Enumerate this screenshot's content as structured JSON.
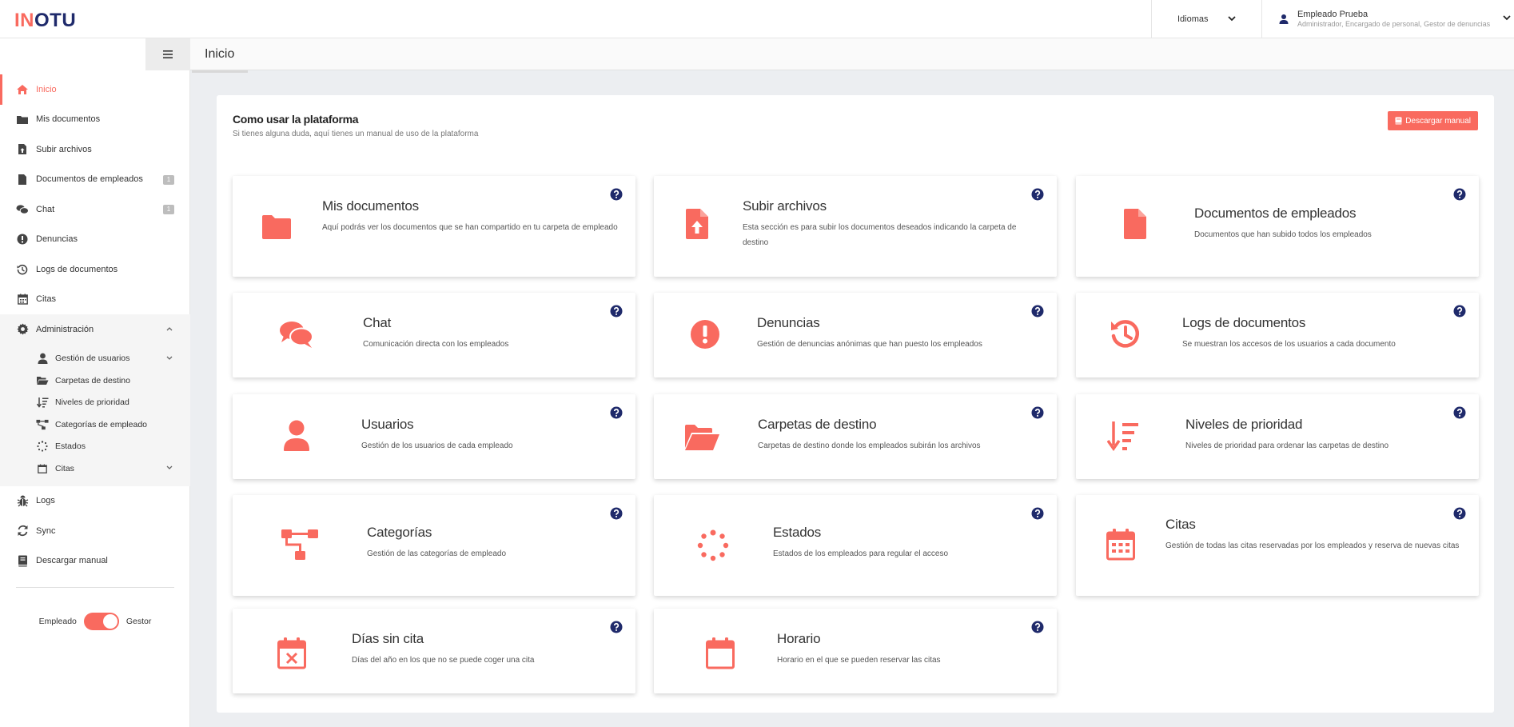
{
  "app": {
    "logo_pre": "IN",
    "logo_post": "OTU",
    "colors": {
      "accent": "#f96a5f",
      "navy": "#1f2a6b"
    }
  },
  "header": {
    "language_label": "Idiomas",
    "user_name": "Empleado Prueba",
    "user_roles": "Administrador, Encargado de personal, Gestor de denuncias"
  },
  "sidebar": {
    "items": [
      {
        "label": "Inicio",
        "icon": "home-icon"
      },
      {
        "label": "Mis documentos",
        "icon": "folder-icon"
      },
      {
        "label": "Subir archivos",
        "icon": "file-upload-icon"
      },
      {
        "label": "Documentos de empleados",
        "icon": "file-icon",
        "badge": "1"
      },
      {
        "label": "Chat",
        "icon": "comments-icon",
        "badge": "1"
      },
      {
        "label": "Denuncias",
        "icon": "exclamation-circle-icon"
      },
      {
        "label": "Logs de documentos",
        "icon": "history-icon"
      },
      {
        "label": "Citas",
        "icon": "calendar-icon"
      },
      {
        "label": "Administración",
        "icon": "cog-icon"
      }
    ],
    "admin_sub": [
      {
        "label": "Gestión de usuarios",
        "icon": "user-icon"
      },
      {
        "label": "Carpetas de destino",
        "icon": "folder-open-icon"
      },
      {
        "label": "Niveles de prioridad",
        "icon": "sort-amount-down-icon"
      },
      {
        "label": "Categorías de empleado",
        "icon": "sitemap-icon"
      },
      {
        "label": "Estados",
        "icon": "spinner-icon"
      },
      {
        "label": "Citas",
        "icon": "calendar-outline-icon"
      }
    ],
    "bottom": [
      {
        "label": "Logs",
        "icon": "bug-icon"
      },
      {
        "label": "Sync",
        "icon": "sync-icon"
      },
      {
        "label": "Descargar manual",
        "icon": "book-icon"
      }
    ],
    "toggle_left": "Empleado",
    "toggle_right": "Gestor"
  },
  "page": {
    "title": "Inicio",
    "panel_title": "Como usar la plataforma",
    "panel_subtitle": "Si tienes alguna duda, aquí tienes un manual de uso de la plataforma",
    "download_button": "Descargar manual"
  },
  "cards": [
    {
      "title": "Mis documentos",
      "desc": "Aquí podrás ver los documentos que se han compartido en tu carpeta de empleado",
      "icon": "folder-icon"
    },
    {
      "title": "Subir archivos",
      "desc": "Esta sección es para subir los documentos deseados indicando la carpeta de destino",
      "icon": "file-upload-icon"
    },
    {
      "title": "Documentos de empleados",
      "desc": "Documentos que han subido todos los empleados",
      "icon": "file-icon"
    },
    {
      "title": "Chat",
      "desc": "Comunicación directa con los empleados",
      "icon": "comments-icon"
    },
    {
      "title": "Denuncias",
      "desc": "Gestión de denuncias anónimas que han puesto los empleados",
      "icon": "exclamation-circle-icon"
    },
    {
      "title": "Logs de documentos",
      "desc": "Se muestran los accesos de los usuarios a cada documento",
      "icon": "history-icon"
    },
    {
      "title": "Usuarios",
      "desc": "Gestión de los usuarios de cada empleado",
      "icon": "user-icon"
    },
    {
      "title": "Carpetas de destino",
      "desc": "Carpetas de destino donde los empleados subirán los archivos",
      "icon": "folder-open-icon"
    },
    {
      "title": "Niveles de prioridad",
      "desc": "Niveles de prioridad para ordenar las carpetas de destino",
      "icon": "sort-amount-down-icon"
    },
    {
      "title": "Categorías",
      "desc": "Gestión de las categorías de empleado",
      "icon": "sitemap-icon"
    },
    {
      "title": "Estados",
      "desc": "Estados de los empleados para regular el acceso",
      "icon": "spinner-icon"
    },
    {
      "title": "Citas",
      "desc": "Gestión de todas las citas reservadas por los empleados y reserva de nuevas citas",
      "icon": "calendar-alt-icon"
    },
    {
      "title": "Días sin cita",
      "desc": "Días del año en los que no se puede coger una cita",
      "icon": "calendar-times-icon"
    },
    {
      "title": "Horario",
      "desc": "Horario en el que se pueden reservar las citas",
      "icon": "calendar-outline-icon"
    }
  ]
}
